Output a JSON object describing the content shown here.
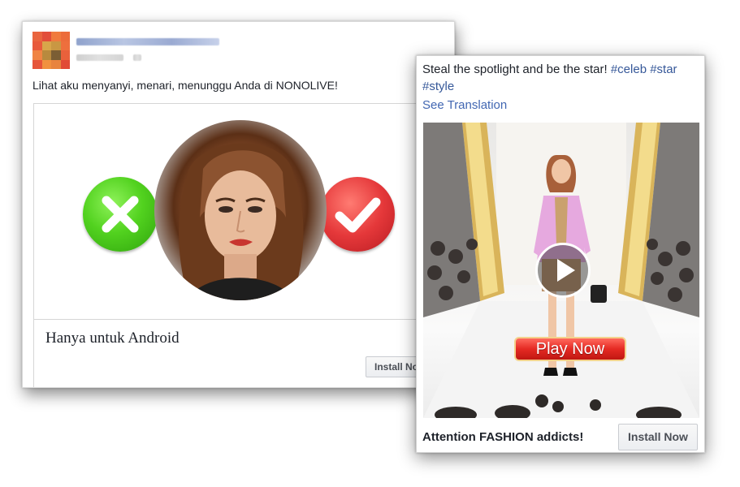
{
  "ad1": {
    "post_text": "Lihat aku menyanyi, menari, menunggu Anda di NONOLIVE!",
    "headline": "Hanya untuk Android",
    "install_label": "Install Now",
    "left_icon": "x-icon",
    "right_icon": "checkmark-icon"
  },
  "ad2": {
    "post_text": "Steal the spotlight and be the star!",
    "hashtags": "#celeb #star #style",
    "see_translation": "See Translation",
    "play_now_label": "Play Now",
    "headline": "Attention FASHION addicts!",
    "install_label": "Install Now",
    "video_icon": "play-icon"
  },
  "colors": {
    "link_blue": "#365899",
    "reject_green": "#52d21f",
    "accept_red": "#e5383a",
    "play_now_red": "#e52a23"
  }
}
